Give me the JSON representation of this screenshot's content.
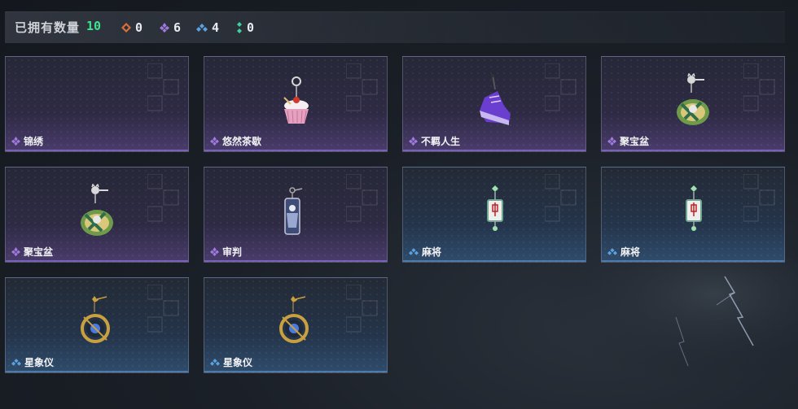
{
  "header": {
    "title": "已拥有数量",
    "count": "10",
    "stats": [
      {
        "icon": "orange-diamond-icon",
        "color": "#d9703a",
        "value": "0"
      },
      {
        "icon": "purple-diamond-icon",
        "color": "#a07ae0",
        "value": "6"
      },
      {
        "icon": "blue-diamond-icon",
        "color": "#5aa2e0",
        "value": "4"
      },
      {
        "icon": "green-diamond-icon",
        "color": "#3fd1a0",
        "value": "0"
      }
    ]
  },
  "items": [
    {
      "name": "锦绣",
      "rarity": "purple",
      "art": "empty"
    },
    {
      "name": "悠然茶歇",
      "rarity": "purple",
      "art": "cupcake-charm"
    },
    {
      "name": "不羁人生",
      "rarity": "purple",
      "art": "sneaker-charm"
    },
    {
      "name": "聚宝盆",
      "rarity": "purple",
      "art": "treasure-bowl-charm"
    },
    {
      "name": "聚宝盆",
      "rarity": "purple",
      "art": "treasure-bowl-charm"
    },
    {
      "name": "审判",
      "rarity": "purple",
      "art": "judgment-card-charm"
    },
    {
      "name": "麻将",
      "rarity": "blue",
      "art": "mahjong-charm"
    },
    {
      "name": "麻将",
      "rarity": "blue",
      "art": "mahjong-charm"
    },
    {
      "name": "星象仪",
      "rarity": "blue",
      "art": "astrolabe-charm"
    },
    {
      "name": "星象仪",
      "rarity": "blue",
      "art": "astrolabe-charm"
    }
  ]
}
